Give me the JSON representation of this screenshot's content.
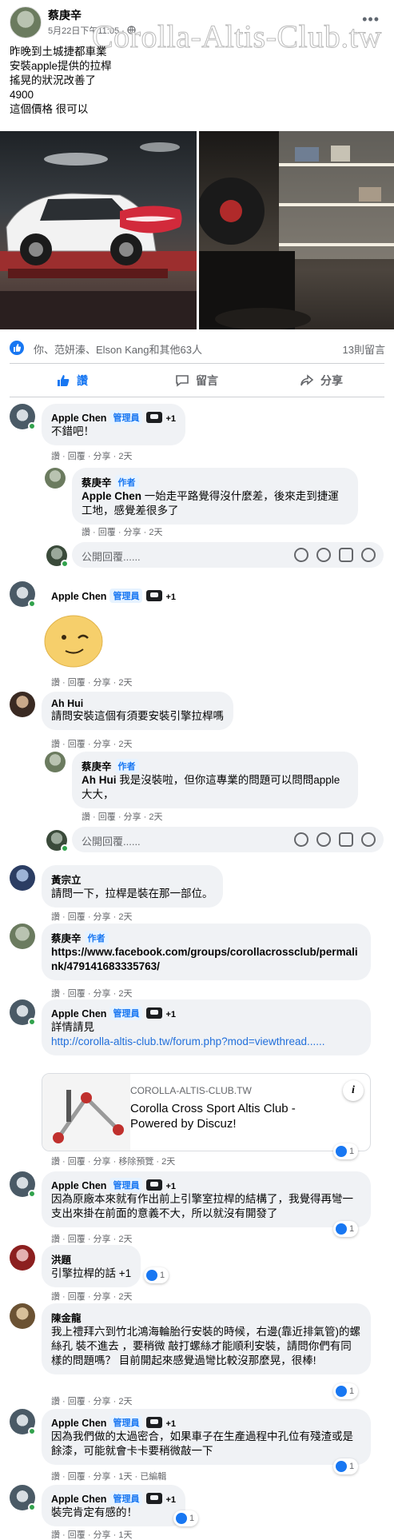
{
  "post": {
    "author": "蔡庚辛",
    "time": "5月22日下午11:05 · ",
    "watermark": "Corolla-Altis-Club.tw",
    "text_lines": [
      "昨晚到土城捷都車業",
      "安裝apple提供的拉桿",
      "搖晃的狀況改善了",
      "4900",
      "這個價格  很可以"
    ],
    "reactions_text": "你、范妍溱、Elson Kang和其他63人",
    "comment_count": "13則留言"
  },
  "actions": {
    "like": "讚",
    "comment": "留言",
    "share": "分享"
  },
  "labels": {
    "admin": "管理員",
    "author_badge": "作者",
    "plus_one": "+1"
  },
  "reply_placeholder": "公開回覆......",
  "comments": {
    "c1": {
      "name": "Apple Chen",
      "text": "不錯吧！",
      "meta": "讚 · 回覆 · 分享 · 2天"
    },
    "c1r": {
      "name": "蔡庚辛",
      "mention": "Apple Chen",
      "text": " 一始走平路覺得沒什麼差，後來走到捷運工地，感覺差很多了",
      "meta": "讚 · 回覆 · 分享 · 2天"
    },
    "c2": {
      "name": "Apple Chen",
      "meta": "讚 · 回覆 · 分享 · 2天"
    },
    "c3": {
      "name": "Ah Hui",
      "text": "請問安裝這個有須要安裝引擎拉桿嗎",
      "meta": "讚 · 回覆 · 分享 · 2天"
    },
    "c3r": {
      "name": "蔡庚辛",
      "mention": "Ah Hui",
      "text": " 我是沒裝啦，但你這專業的問題可以問問apple大大，",
      "meta": "讚 · 回覆 · 分享 · 2天"
    },
    "c4": {
      "name": "黃宗立",
      "text": "請問一下，拉桿是裝在那一部位。",
      "meta": "讚 · 回覆 · 分享 · 2天"
    },
    "c5": {
      "name": "蔡庚辛",
      "text": "https://www.facebook.com/groups/corollacrossclub/permalink/479141683335763/",
      "meta": "讚 · 回覆 · 分享 · 2天"
    },
    "c6": {
      "name": "Apple Chen",
      "text": "詳情請見",
      "link": "http://corolla-altis-club.tw/forum.php?mod=viewthread......",
      "card_domain": "COROLLA-ALTIS-CLUB.TW",
      "card_title": "Corolla Cross Sport Altis Club - Powered by Discuz!",
      "info": "i",
      "meta": "讚 · 回覆 · 分享 · 移除預覽 · 2天",
      "react": "1"
    },
    "c7": {
      "name": "Apple Chen",
      "text": "因為原廠本來就有作出前上引擎室拉桿的結構了，我覺得再彎一支出來掛在前面的意義不大，所以就沒有開發了",
      "meta": "讚 · 回覆 · 分享 · 2天",
      "react": "1"
    },
    "c8": {
      "name": "洪題",
      "text": "引擎拉桿的話 +1",
      "meta": "讚 · 回覆 · 分享 · 2天",
      "react": "1"
    },
    "c9": {
      "name": "陳金龍",
      "text": "我上禮拜六到竹北鴻海輪胎行安裝的時候，右邊(靠近排氣管)的螺絲孔 裝不進去 ，要稍微 敲打螺絲才能順利安裝，請問你們有同樣的問題嗎？ 目前開起來感覺過彎比較沒那麼晃，很棒!",
      "meta": "讚 · 回覆 · 分享 · 2天",
      "react": "1"
    },
    "c10": {
      "name": "Apple Chen",
      "text": "因為我們做的太過密合，如果車子在生產過程中孔位有殘渣或是餘漆，可能就會卡卡要稍微敲一下",
      "meta": "讚 · 回覆 · 分享 · 1天 · 已編輯",
      "react": "1"
    },
    "c11": {
      "name": "Apple Chen",
      "text": "裝完肯定有感的！",
      "meta": "讚 · 回覆 · 分享 · 1天",
      "react": "1"
    }
  },
  "colors": {
    "facebook_blue": "#1877f2",
    "bubble": "#f0f2f5",
    "meta_gray": "#65676b",
    "online_green": "#31a24c"
  }
}
